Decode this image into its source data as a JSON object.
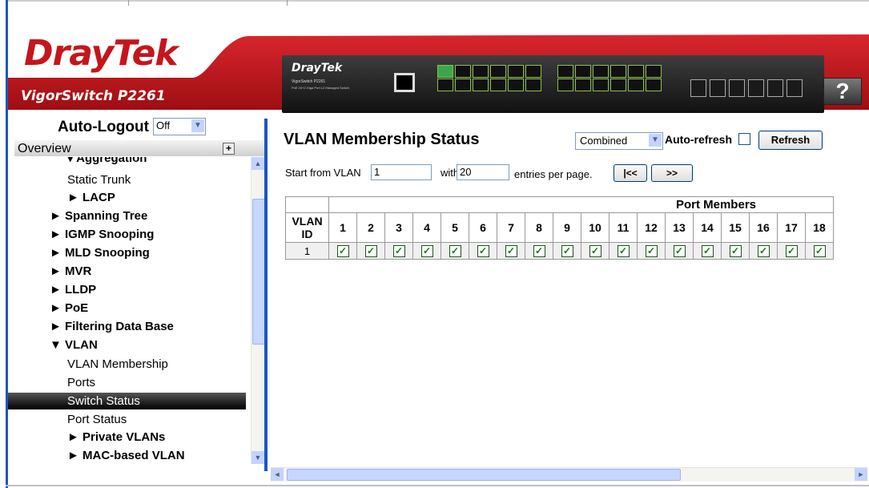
{
  "header": {
    "brand": "DrayTek",
    "model": "VigorSwitch P2261",
    "help_label": "?",
    "switch_brand": "DrayTek",
    "switch_model": "VigorSwitch P2261",
    "switch_desc": "PoE 24+2 Giga Port L2 Managed Switch",
    "accent_color": "#c4161c"
  },
  "nav": {
    "autologout_label": "Auto-Logout",
    "autologout_value": "Off",
    "overview_label": "Overview",
    "plus_icon": "+",
    "items": [
      {
        "label": "▾ Aggregation",
        "level": "section-partial"
      },
      {
        "label": "Static Trunk",
        "level": "sub"
      },
      {
        "label": "► LACP",
        "level": "subgroup"
      },
      {
        "label": "► Spanning Tree",
        "level": "group"
      },
      {
        "label": "► IGMP Snooping",
        "level": "group"
      },
      {
        "label": "► MLD Snooping",
        "level": "group"
      },
      {
        "label": "► MVR",
        "level": "group"
      },
      {
        "label": "► LLDP",
        "level": "group"
      },
      {
        "label": "► PoE",
        "level": "group"
      },
      {
        "label": "► Filtering Data Base",
        "level": "group"
      },
      {
        "label": "▼ VLAN",
        "level": "group"
      },
      {
        "label": "VLAN Membership",
        "level": "sub"
      },
      {
        "label": "Ports",
        "level": "sub"
      },
      {
        "label": "Switch Status",
        "level": "sub",
        "selected": true
      },
      {
        "label": "Port Status",
        "level": "sub"
      },
      {
        "label": "► Private VLANs",
        "level": "subgroup"
      },
      {
        "label": "► MAC-based VLAN",
        "level": "subgroup"
      }
    ]
  },
  "main": {
    "title": "VLAN Membership Status",
    "view_select": "Combined",
    "auto_refresh_label": "Auto-refresh",
    "refresh_label": "Refresh",
    "start_from_label": "Start from VLAN",
    "start_from_value": "1",
    "with_label": "with",
    "with_value": "20",
    "entries_label": "entries per page.",
    "first_label": "|<<",
    "next_label": ">>"
  },
  "table": {
    "port_members_label": "Port Members",
    "vlan_id_label": "VLAN ID",
    "ports": [
      "1",
      "2",
      "3",
      "4",
      "5",
      "6",
      "7",
      "8",
      "9",
      "10",
      "11",
      "12",
      "13",
      "14",
      "15",
      "16",
      "17",
      "18"
    ],
    "rows": [
      {
        "vlan_id": "1",
        "members": [
          true,
          true,
          true,
          true,
          true,
          true,
          true,
          true,
          true,
          true,
          true,
          true,
          true,
          true,
          true,
          true,
          true,
          true
        ]
      }
    ]
  }
}
